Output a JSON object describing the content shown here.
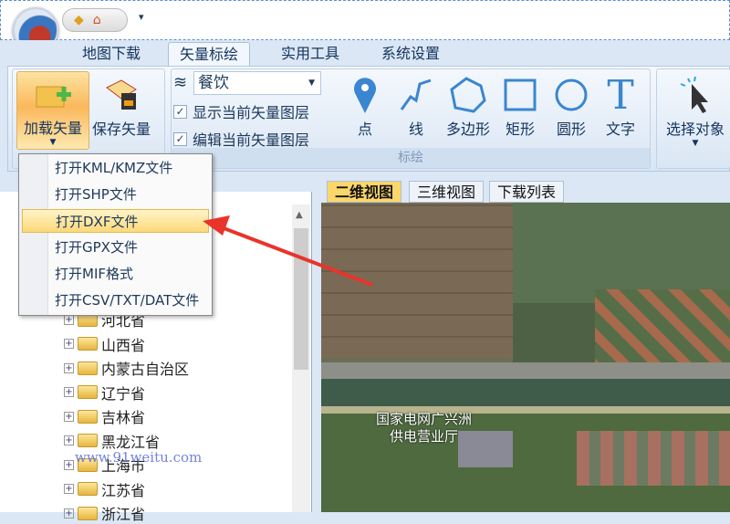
{
  "quick_access": {
    "icons": [
      "tag-icon",
      "home-icon"
    ],
    "more": "▾"
  },
  "tabs": [
    "地图下载",
    "矢量标绘",
    "实用工具",
    "系统设置"
  ],
  "active_tab": 1,
  "ribbon": {
    "load_vector": "加载矢量",
    "save_vector": "保存矢量",
    "layer_combo": "餐饮",
    "show_layer": "显示当前矢量图层",
    "edit_layer": "编辑当前矢量图层",
    "draw_tools": [
      "点",
      "线",
      "多边形",
      "矩形",
      "圆形",
      "文字"
    ],
    "draw_group": "标绘",
    "select_object": "选择对象"
  },
  "load_menu": {
    "items": [
      "打开KML/KMZ文件",
      "打开SHP文件",
      "打开DXF文件",
      "打开GPX文件",
      "打开MIF格式",
      "打开CSV/TXT/DAT文件"
    ],
    "highlighted": 2
  },
  "tree": [
    "河北省",
    "山西省",
    "内蒙古自治区",
    "辽宁省",
    "吉林省",
    "黑龙江省",
    "上海市",
    "江苏省",
    "浙江省"
  ],
  "map_tabs": [
    "二维视图",
    "三维视图",
    "下载列表"
  ],
  "map": {
    "label_line1": "国家电网广兴洲",
    "label_line2": "供电营业厅"
  },
  "watermark": "www.91weitu.com",
  "colors": {
    "accent": "#3a86d0",
    "highlight": "#fcd97a",
    "arrow": "#e8342a"
  }
}
